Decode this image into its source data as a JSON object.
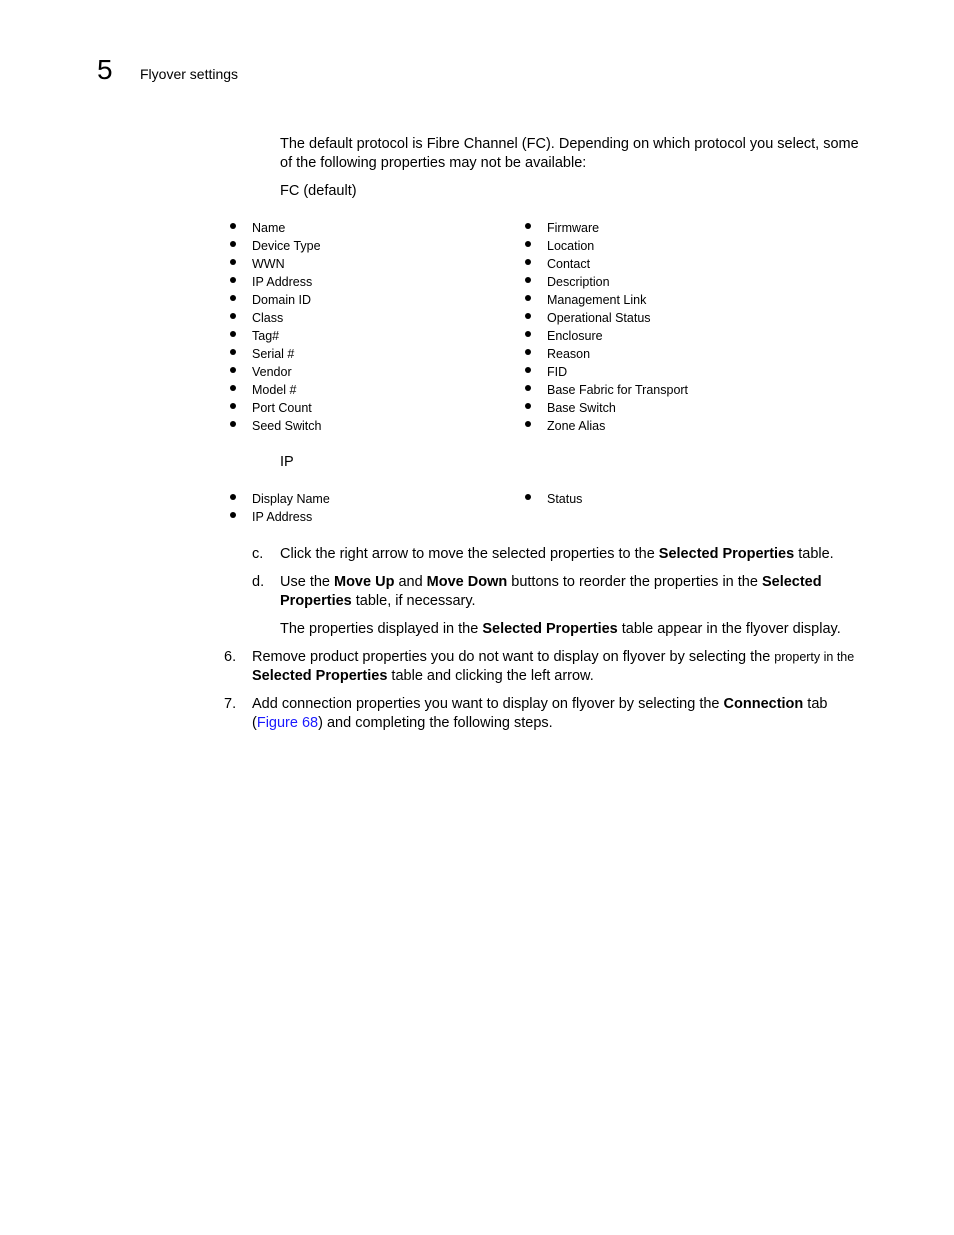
{
  "header": {
    "chapter_number": "5",
    "chapter_title": "Flyover settings"
  },
  "intro": {
    "text": "The default protocol is Fibre Channel (FC). Depending on which protocol you select, some of the following properties may not be available:",
    "fc_heading": "FC (default)",
    "ip_heading": "IP"
  },
  "fc_properties": {
    "left": [
      "Name",
      "Device Type",
      "WWN",
      "IP Address",
      "Domain ID",
      "Class",
      "Tag#",
      "Serial #",
      "Vendor",
      "Model #",
      "Port Count",
      "Seed Switch"
    ],
    "right": [
      "Firmware",
      "Location",
      "Contact",
      "Description",
      "Management Link",
      "Operational Status",
      "Enclosure",
      "Reason",
      "FID",
      "Base Fabric for Transport",
      "Base Switch",
      "Zone Alias"
    ]
  },
  "ip_properties": {
    "left": [
      "Display Name",
      "IP Address"
    ],
    "right": [
      "Status"
    ]
  },
  "steps": {
    "c": {
      "label": "c.",
      "t1": "Click the right arrow to move the selected properties to the ",
      "b1": "Selected Properties",
      "t2": " table."
    },
    "d": {
      "label": "d.",
      "t1": "Use the ",
      "b1": "Move Up",
      "t2": " and ",
      "b2": "Move Down",
      "t3": " buttons to reorder the properties in the ",
      "b3": "Selected Properties",
      "t4": " table, if necessary.",
      "note_t1": "The properties displayed in the ",
      "note_b1": "Selected Properties",
      "note_t2": " table appear in the flyover display."
    },
    "s6": {
      "label": "6.",
      "t1": "Remove product properties you do not want to display on flyover by selecting the ",
      "small": "property in the",
      "b1": "Selected Properties",
      "t2": " table and clicking the left arrow."
    },
    "s7": {
      "label": "7.",
      "t1": "Add connection properties you want to display on flyover by selecting the ",
      "b1": "Connection",
      "t2": " tab (",
      "link": "Figure 68",
      "t3": ") and completing the following steps."
    }
  }
}
